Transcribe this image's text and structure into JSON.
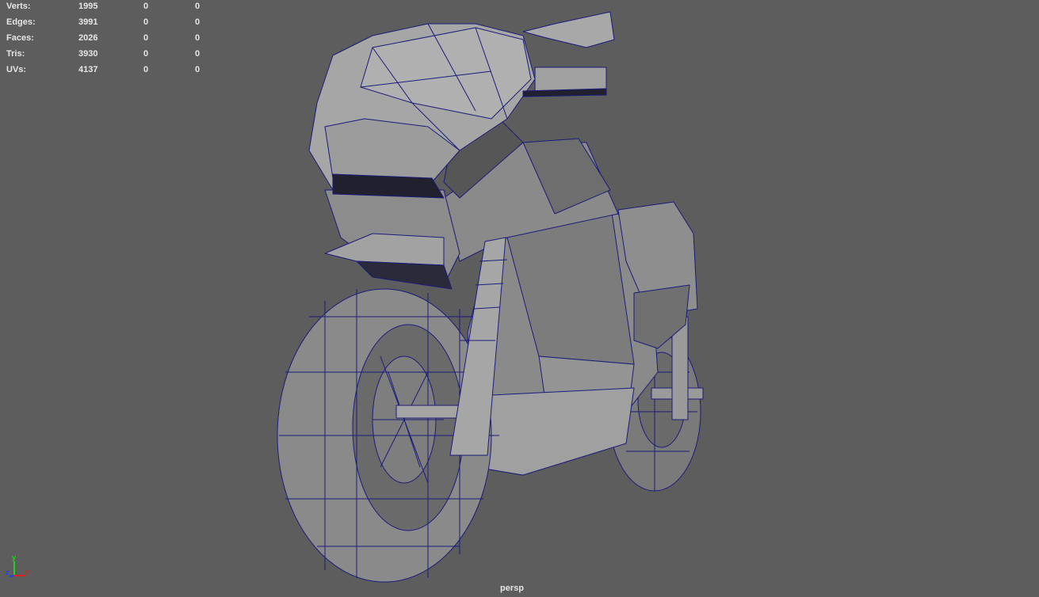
{
  "hud": {
    "rows": [
      {
        "label": "Verts:",
        "v1": "1995",
        "v2": "0",
        "v3": "0"
      },
      {
        "label": "Edges:",
        "v1": "3991",
        "v2": "0",
        "v3": "0"
      },
      {
        "label": "Faces:",
        "v1": "2026",
        "v2": "0",
        "v3": "0"
      },
      {
        "label": "Tris:",
        "v1": "3930",
        "v2": "0",
        "v3": "0"
      },
      {
        "label": "UVs:",
        "v1": "4137",
        "v2": "0",
        "v3": "0"
      }
    ]
  },
  "viewport": {
    "camera": "persp",
    "wire_color": "#1c1c7a",
    "shade_color": "#8c8c8c"
  },
  "axis": {
    "x": "x",
    "y": "y",
    "z": "z",
    "x_color": "#e02020",
    "y_color": "#20d020",
    "z_color": "#2040e0"
  }
}
